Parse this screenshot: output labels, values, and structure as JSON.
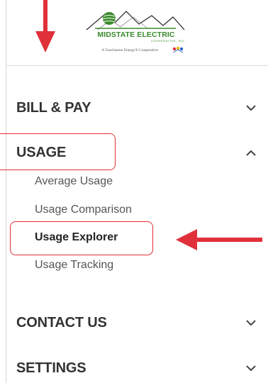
{
  "logo": {
    "name": "MIDSTATE ELECTRIC",
    "subtitle": "COOPERATIVE, INC.",
    "tagline": "A Touchstone Energy® Cooperative",
    "brand_color": "#3a8a2c"
  },
  "menu": {
    "bill_pay": {
      "label": "BILL & PAY",
      "icon": "chevron-down-icon"
    },
    "usage": {
      "label": "USAGE",
      "icon": "chevron-up-icon",
      "items": [
        "Average Usage",
        "Usage Comparison",
        "Usage Explorer",
        "Usage Tracking"
      ],
      "active_item": "Usage Explorer"
    },
    "contact_us": {
      "label": "CONTACT US",
      "icon": "chevron-down-icon"
    },
    "settings": {
      "label": "SETTINGS",
      "icon": "chevron-down-icon"
    }
  },
  "annotations": {
    "color": "#e0303a"
  }
}
